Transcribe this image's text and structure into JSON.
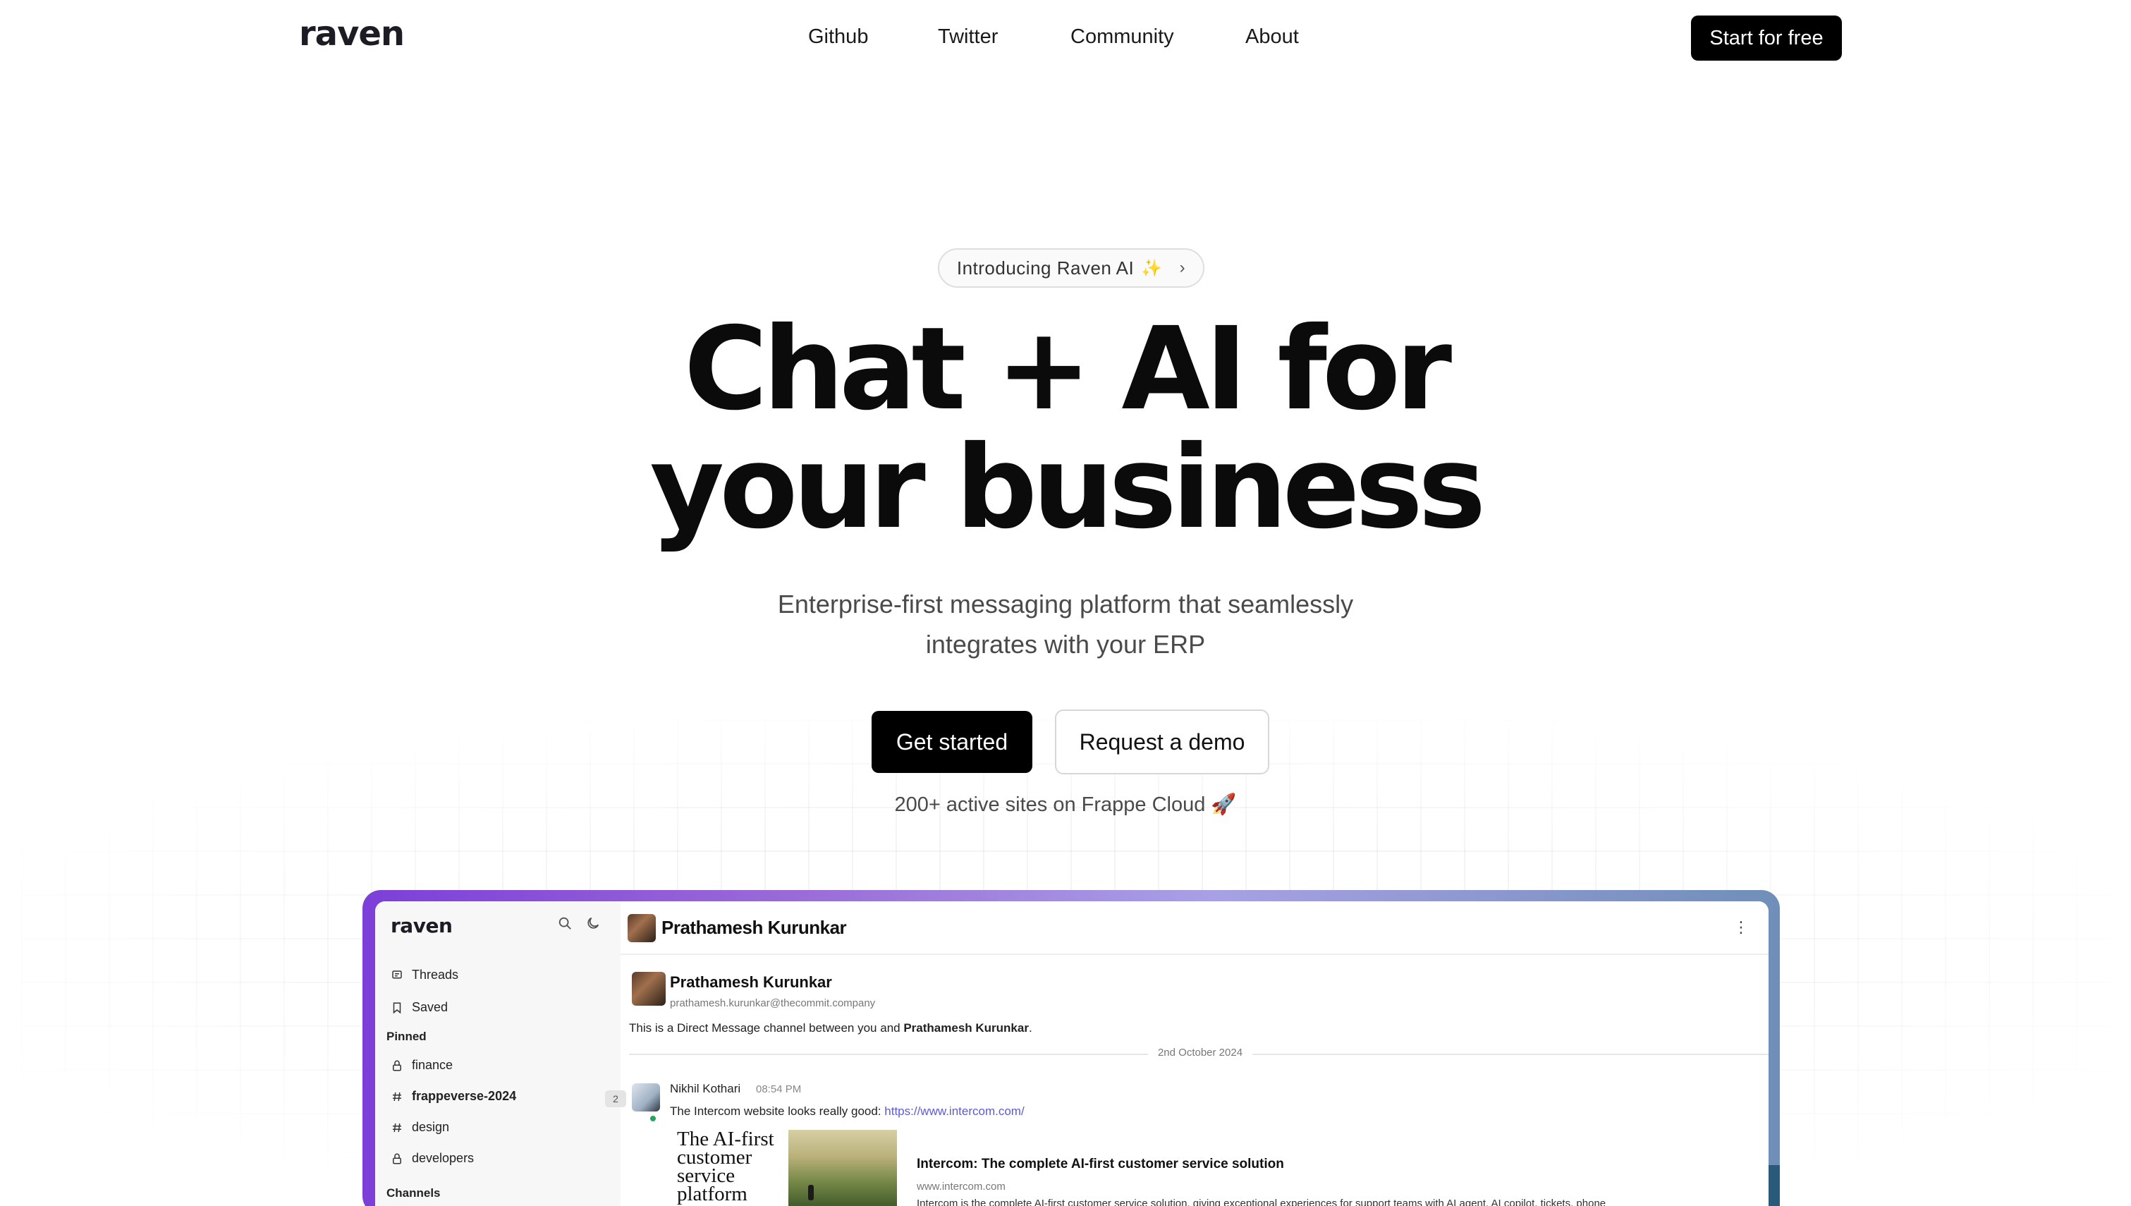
{
  "nav": {
    "logo": "raven",
    "links": [
      "Github",
      "Twitter",
      "Community",
      "About"
    ],
    "cta": "Start for free"
  },
  "hero": {
    "pill_label": "Introducing Raven AI",
    "pill_sparkle": "✨",
    "pill_chevron": "›",
    "title_line1": "Chat + AI for",
    "title_line2": "your business",
    "subtitle_line1": "Enterprise-first messaging platform that seamlessly",
    "subtitle_line2": "integrates with your ERP",
    "primary_button": "Get started",
    "secondary_button": "Request a demo",
    "active_sites": "200+ active sites on Frappe Cloud 🚀"
  },
  "app": {
    "sidebar": {
      "logo": "raven",
      "items": [
        {
          "label": "Threads",
          "icon": "threads-icon"
        },
        {
          "label": "Saved",
          "icon": "bookmark-icon"
        }
      ],
      "pinned_header": "Pinned",
      "pinned": [
        {
          "label": "finance",
          "icon": "lock-icon"
        },
        {
          "label": "frappeverse-2024",
          "icon": "hash-icon",
          "badge": "2"
        },
        {
          "label": "design",
          "icon": "hash-icon"
        },
        {
          "label": "developers",
          "icon": "lock-icon"
        }
      ],
      "channels_header": "Channels"
    },
    "chat": {
      "header_name": "Prathamesh Kurunkar",
      "intro_name": "Prathamesh Kurunkar",
      "intro_email": "prathamesh.kurunkar@thecommit.company",
      "intro_text_prefix": "This is a Direct Message channel between you and",
      "intro_text_name": "Prathamesh Kurunkar",
      "intro_text_suffix": ".",
      "date_separator": "2nd October 2024",
      "message": {
        "sender": "Nikhil Kothari",
        "time": "08:54 PM",
        "text": "The Intercom website looks really good:",
        "link": "https://www.intercom.com/"
      },
      "link_preview": {
        "ad_text": "The AI-first customer service platform",
        "title": "Intercom: The complete AI-first customer service solution",
        "domain": "www.intercom.com",
        "description": "Intercom is the complete AI-first customer service solution, giving exceptional experiences for support teams with AI agent, AI copilot, tickets, phone"
      }
    }
  },
  "colors": {
    "primary_button": "#000000",
    "frame_gradient_start": "#7c3fd9",
    "frame_gradient_end": "#6f8fb8",
    "link": "#5b5bd6",
    "online": "#23a55a"
  }
}
